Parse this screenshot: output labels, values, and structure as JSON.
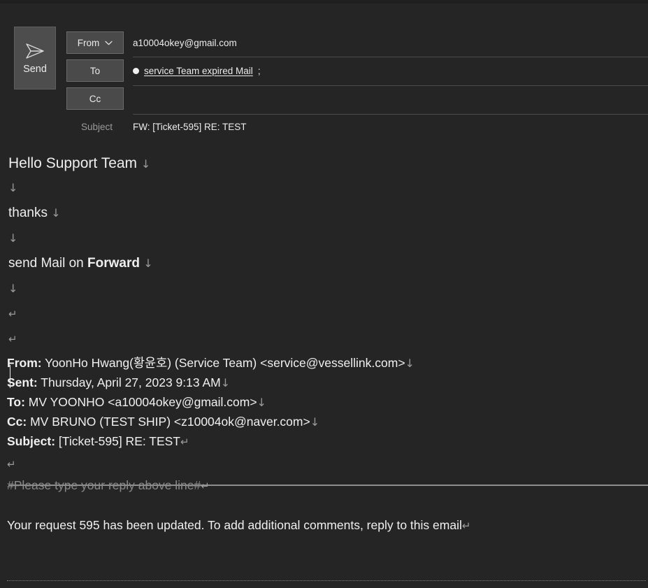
{
  "window": {
    "app": "mail-compose",
    "theme_bg": "#252525",
    "accent": "#4a4a4a"
  },
  "toolbar": {
    "send_label": "Send",
    "send_icon": "paper-plane-icon"
  },
  "fields": {
    "from": {
      "button_label": "From",
      "chevron_icon": "chevron-down-icon",
      "value": "a10004okey@gmail.com"
    },
    "to": {
      "button_label": "To",
      "presence_icon": "presence-dot-icon",
      "recipient": "service Team expired Mail",
      "separator": ";"
    },
    "cc": {
      "button_label": "Cc",
      "value": ""
    },
    "subject": {
      "label": "Subject",
      "value": "FW: [Ticket-595] RE: TEST"
    }
  },
  "body": {
    "lines": [
      {
        "text": "Hello Support Team",
        "mark": "↓",
        "bold_part": ""
      },
      {
        "text": "",
        "mark": "↓",
        "bold_part": ""
      },
      {
        "text": "thanks",
        "mark": "↓",
        "bold_part": ""
      },
      {
        "text": "",
        "mark": "↓",
        "bold_part": ""
      },
      {
        "text": "send Mail on ",
        "mark": "↓",
        "bold_part": "Forward"
      },
      {
        "text": "",
        "mark": "↓",
        "bold_part": ""
      },
      {
        "text": "",
        "mark": "↵",
        "bold_part": ""
      },
      {
        "text": "",
        "mark": "↵",
        "bold_part": ""
      }
    ]
  },
  "quoted": {
    "from_label": "From:",
    "from_value": "YoonHo Hwang(황윤호) (Service Team) <service@vessellink.com>",
    "from_mark": "↓",
    "sent_label": "Sent:",
    "sent_value": "Thursday, April 27, 2023 9:13 AM",
    "sent_mark": "↓",
    "to_label": "To:",
    "to_value": "MV YOONHO <a10004okey@gmail.com>",
    "to_mark": "↓",
    "cc_label": "Cc:",
    "cc_value": "MV BRUNO (TEST SHIP) <z10004ok@naver.com>",
    "cc_mark": "↓",
    "subject_label": "Subject:",
    "subject_value": "[Ticket-595] RE: TEST",
    "subject_mark": "↵",
    "blank_mark": "↵",
    "notice": "#Please type your reply above line#",
    "notice_mark": "↵",
    "message": "Your request 595 has been updated. To add additional comments, reply to this email",
    "message_mark": "↵"
  }
}
